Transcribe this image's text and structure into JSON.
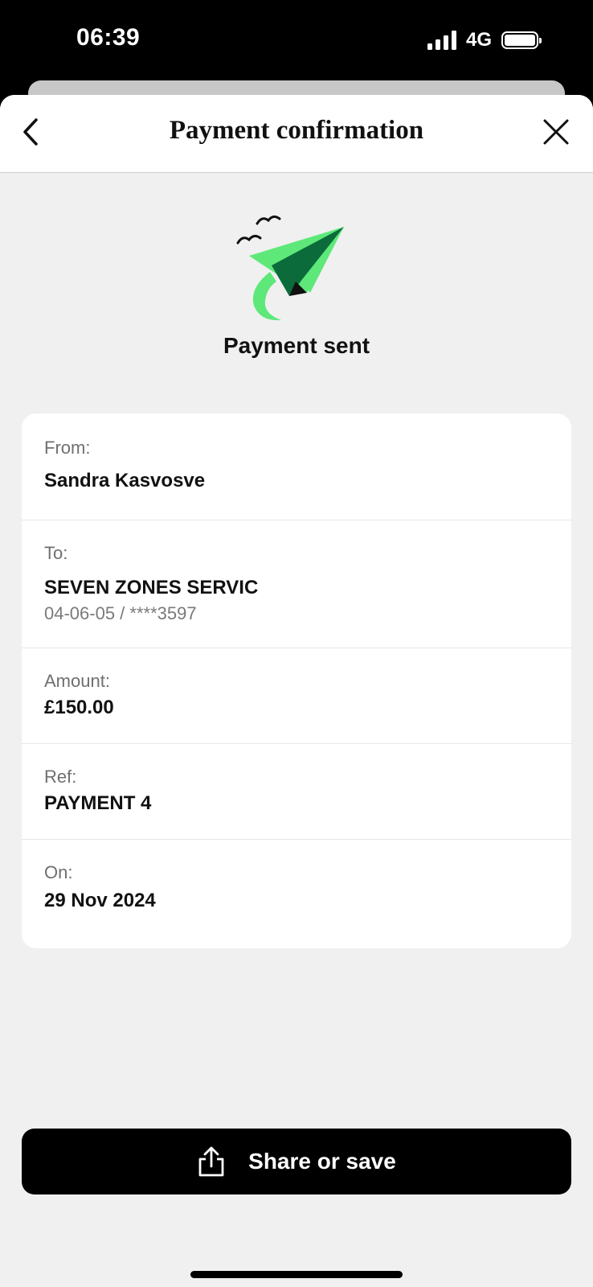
{
  "status_bar": {
    "time": "06:39",
    "network": "4G",
    "signal_icon": "signal-bars-icon",
    "battery_icon": "battery-full-icon"
  },
  "header": {
    "title": "Payment confirmation",
    "back_icon": "chevron-left-icon",
    "close_icon": "close-icon"
  },
  "hero": {
    "illustration": "paper-plane-icon",
    "title": "Payment sent"
  },
  "details": {
    "from": {
      "label": "From:",
      "value": "Sandra Kasvosve"
    },
    "to": {
      "label": "To:",
      "value": "SEVEN ZONES SERVIC",
      "account": "04-06-05 / ****3597"
    },
    "amount": {
      "label": "Amount:",
      "value": "£150.00"
    },
    "ref": {
      "label": "Ref:",
      "value": "PAYMENT 4"
    },
    "on": {
      "label": "On:",
      "value": "29 Nov 2024"
    }
  },
  "actions": {
    "share_label": "Share or save",
    "share_icon": "share-icon"
  },
  "colors": {
    "background": "#f0f0f0",
    "card": "#ffffff",
    "primary_button": "#000000",
    "plane_light_green": "#5ee87a",
    "plane_dark_green": "#0b6b3a"
  }
}
